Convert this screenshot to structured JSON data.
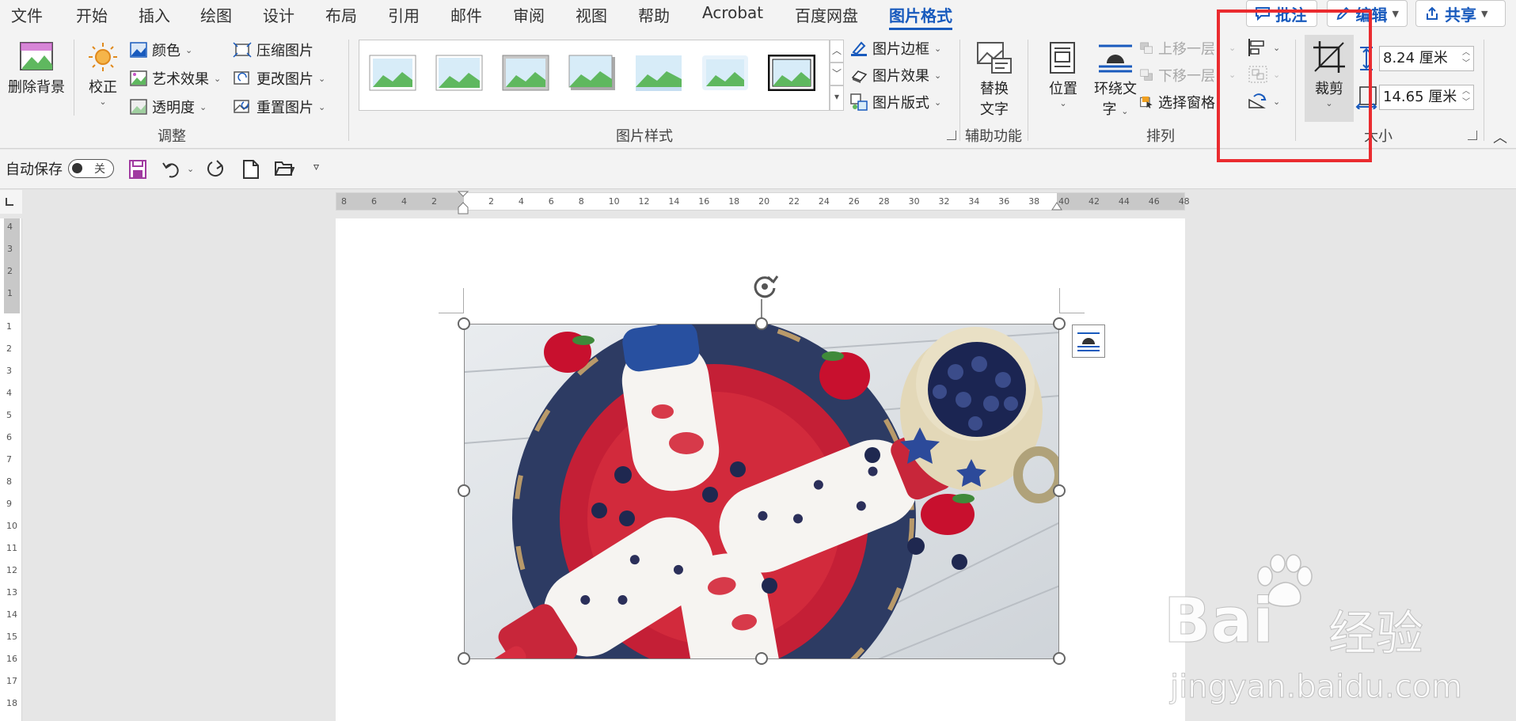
{
  "tabs": [
    {
      "label": "文件"
    },
    {
      "label": "开始"
    },
    {
      "label": "插入"
    },
    {
      "label": "绘图"
    },
    {
      "label": "设计"
    },
    {
      "label": "布局"
    },
    {
      "label": "引用"
    },
    {
      "label": "邮件"
    },
    {
      "label": "审阅"
    },
    {
      "label": "视图"
    },
    {
      "label": "帮助"
    },
    {
      "label": "Acrobat"
    },
    {
      "label": "百度网盘"
    },
    {
      "label": "图片格式",
      "active": true
    }
  ],
  "top_buttons": {
    "comment": "批注",
    "edit": "编辑",
    "share": "共享"
  },
  "groups": {
    "adjust": {
      "label": "调整",
      "remove_background": "删除背景",
      "corrections": "校正",
      "color": "颜色",
      "artistic_effects": "艺术效果",
      "transparency": "透明度",
      "compress": "压缩图片",
      "change_picture": "更改图片",
      "reset_picture": "重置图片"
    },
    "picture_styles": {
      "label": "图片样式",
      "border": "图片边框",
      "effects": "图片效果",
      "layout": "图片版式"
    },
    "accessibility": {
      "label": "辅助功能",
      "alt_text_line1": "替换",
      "alt_text_line2": "文字"
    },
    "arrange": {
      "label": "排列",
      "position": "位置",
      "wrap_text_line1": "环绕文",
      "wrap_text_line2": "字",
      "bring_forward": "上移一层",
      "send_backward": "下移一层",
      "selection_pane": "选择窗格"
    },
    "size": {
      "label": "大小",
      "crop": "裁剪",
      "height": "8.24 厘米",
      "width": "14.65 厘米"
    }
  },
  "qat": {
    "autosave_label": "自动保存",
    "autosave_state": "关"
  },
  "ruler": {
    "horizontal_left": [
      "8",
      "6",
      "4",
      "2"
    ],
    "horizontal_right": [
      "2",
      "4",
      "6",
      "8",
      "10",
      "12",
      "14",
      "16",
      "18",
      "20",
      "22",
      "24",
      "26",
      "28",
      "30",
      "32",
      "34",
      "36",
      "38",
      "40",
      "42",
      "44",
      "46",
      "48"
    ],
    "vertical_top": [
      "4",
      "3",
      "2",
      "1"
    ],
    "vertical_body": [
      "1",
      "2",
      "3",
      "4",
      "5",
      "6",
      "7",
      "8",
      "9",
      "10",
      "11",
      "12",
      "13",
      "14",
      "15",
      "16",
      "17",
      "18"
    ]
  },
  "watermark": {
    "brand": "Bai",
    "brand_cn": "经验",
    "url": "jingyan.baidu.com"
  },
  "colors": {
    "accent": "#185abd",
    "highlight": "#ea2b2f"
  }
}
